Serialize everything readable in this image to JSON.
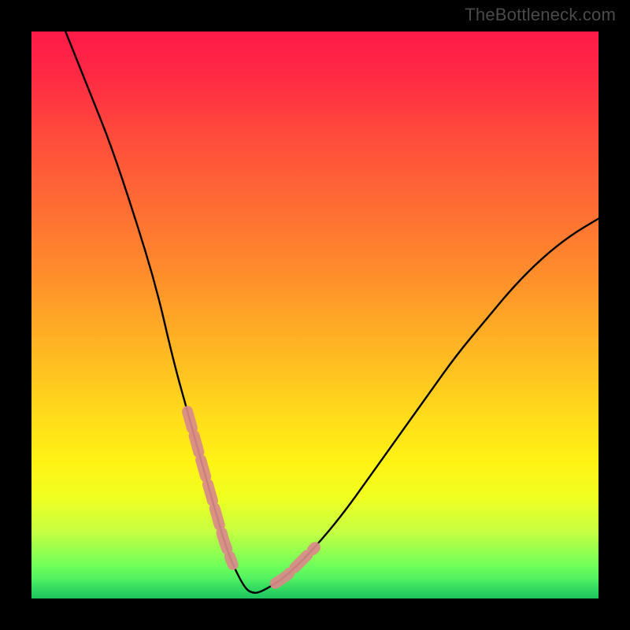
{
  "watermark": {
    "text": "TheBottleneck.com"
  },
  "chart_data": {
    "type": "line",
    "title": "",
    "xlabel": "",
    "ylabel": "",
    "xlim": [
      0,
      100
    ],
    "ylim": [
      0,
      100
    ],
    "grid": false,
    "legend": false,
    "series": [
      {
        "name": "bottleneck-curve",
        "x": [
          6,
          10,
          14,
          18,
          22,
          25,
          27.5,
          30,
          32,
          34,
          35.5,
          37,
          38,
          39,
          40,
          42,
          45,
          50,
          55,
          60,
          65,
          70,
          75,
          80,
          85,
          90,
          95,
          100
        ],
        "y": [
          100,
          90,
          80,
          68,
          55,
          42,
          33,
          24,
          17,
          10,
          6,
          3,
          1.5,
          1,
          1,
          2,
          4,
          9,
          15,
          22,
          29,
          36,
          43,
          49,
          55,
          60,
          64,
          67
        ]
      }
    ],
    "highlight_segments": [
      {
        "name": "left-highlight",
        "x_from": 27.5,
        "x_to": 35.5
      },
      {
        "name": "right-highlight",
        "x_from": 43,
        "x_to": 50
      }
    ],
    "colors": {
      "curve": "#000000",
      "highlight": "#d98a8a",
      "gradient_top": "#ff1a49",
      "gradient_bottom": "#22e06a"
    }
  }
}
